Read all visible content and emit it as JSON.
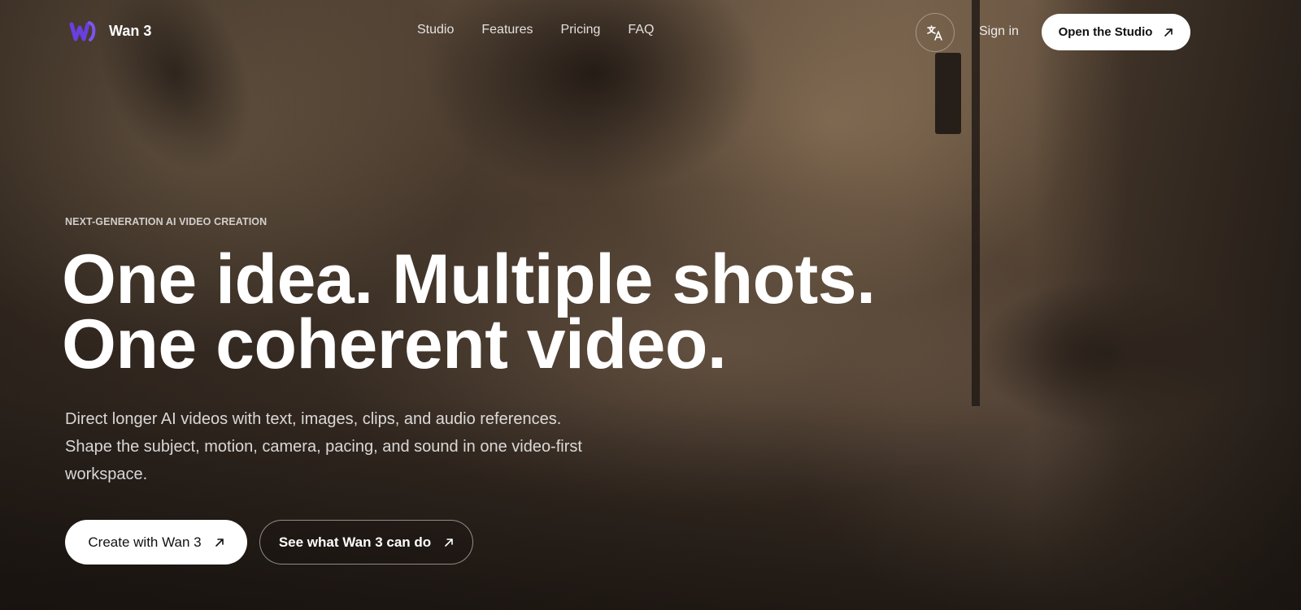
{
  "brand": {
    "name": "Wan 3",
    "logo_icon": "wan-logo-icon",
    "accent": "#6a3fe0"
  },
  "nav": {
    "items": [
      "Studio",
      "Features",
      "Pricing",
      "FAQ"
    ]
  },
  "header": {
    "language_icon": "translate-icon",
    "signin_label": "Sign in",
    "open_studio_label": "Open the Studio"
  },
  "hero": {
    "eyebrow": "NEXT-GENERATION AI VIDEO CREATION",
    "headline_line1": "One idea. Multiple shots.",
    "headline_line2": "One coherent video.",
    "subtitle": "Direct longer AI videos with text, images, clips, and audio references. Shape the subject, motion, camera, pacing, and sound in one video-first workspace.",
    "cta_primary": "Create with Wan 3",
    "cta_secondary": "See what Wan 3 can do",
    "arrow_icon": "arrow-up-right-icon"
  }
}
